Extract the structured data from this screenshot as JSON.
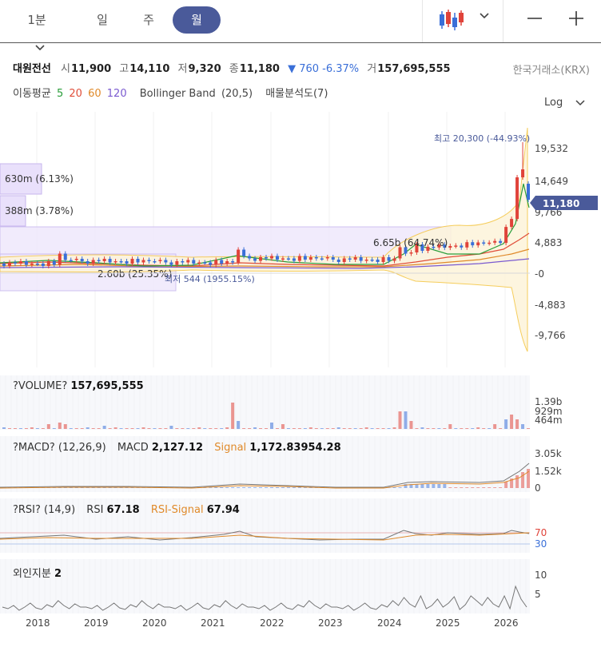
{
  "periods": [
    {
      "label": "1분",
      "selected": false
    },
    {
      "label": "일",
      "selected": false
    },
    {
      "label": "주",
      "selected": false
    },
    {
      "label": "월",
      "selected": true
    }
  ],
  "stock": {
    "name": "대원전선",
    "open_label": "시",
    "open": "11,900",
    "high_label": "고",
    "high": "14,110",
    "low_label": "저",
    "low": "9,320",
    "close_label": "종",
    "close": "11,180",
    "change": "▼ 760 -6.37%",
    "volume_label": "거",
    "volume": "157,695,555",
    "exchange": "한국거래소(KRX)"
  },
  "indicators": {
    "ma_label": "이동평균",
    "ma_periods": [
      "5",
      "20",
      "60",
      "120"
    ],
    "ma_colors": [
      "#2a9d3a",
      "#e04e3a",
      "#e08a2a",
      "#7a5ad0"
    ],
    "bollinger": "Bollinger Band",
    "bollinger_params": "(20,5)",
    "volume_profile": "매물분석도(7)"
  },
  "scale_mode": "Log",
  "price_chart": {
    "y_ticks": [
      "19,532",
      "14,649",
      "9,766",
      "4,883",
      "-0",
      "-4,883",
      "-9,766"
    ],
    "current_price": "11,180",
    "high_annotation": "최고 20,300 (-44.93%)",
    "low_annotation": "최저 544 (1955.15%)",
    "profile_labels": [
      "630m (6.13%)",
      "388m (3.78%)",
      "2.60b (25.35%)",
      "6.65b (64.74%)"
    ]
  },
  "volume_panel": {
    "title": "?VOLUME?",
    "value": "157,695,555",
    "y_ticks": [
      "1.39b",
      "929m",
      "464m"
    ]
  },
  "macd_panel": {
    "title": "?MACD? (12,26,9)",
    "macd_label": "MACD",
    "macd_value": "2,127.12",
    "signal_label": "Signal",
    "signal_value": "1,172.83954.28",
    "y_ticks": [
      "3.05k",
      "1.52k",
      "0"
    ]
  },
  "rsi_panel": {
    "title": "?RSI? (14,9)",
    "rsi_label": "RSI",
    "rsi_value": "67.18",
    "signal_label": "RSI-Signal",
    "signal_value": "67.94",
    "y_ticks": [
      "70",
      "30"
    ]
  },
  "foreign_panel": {
    "title": "외인지분",
    "value": "2",
    "y_ticks": [
      "10",
      "5"
    ]
  },
  "x_axis": [
    "2018",
    "2019",
    "2020",
    "2021",
    "2022",
    "2023",
    "2024",
    "2025",
    "2026"
  ],
  "colors": {
    "up": "#e0433a",
    "down": "#3a6fd8",
    "accent": "#4a5a9a",
    "band": "#f5c84a",
    "profile": "#b9a3e8"
  }
}
